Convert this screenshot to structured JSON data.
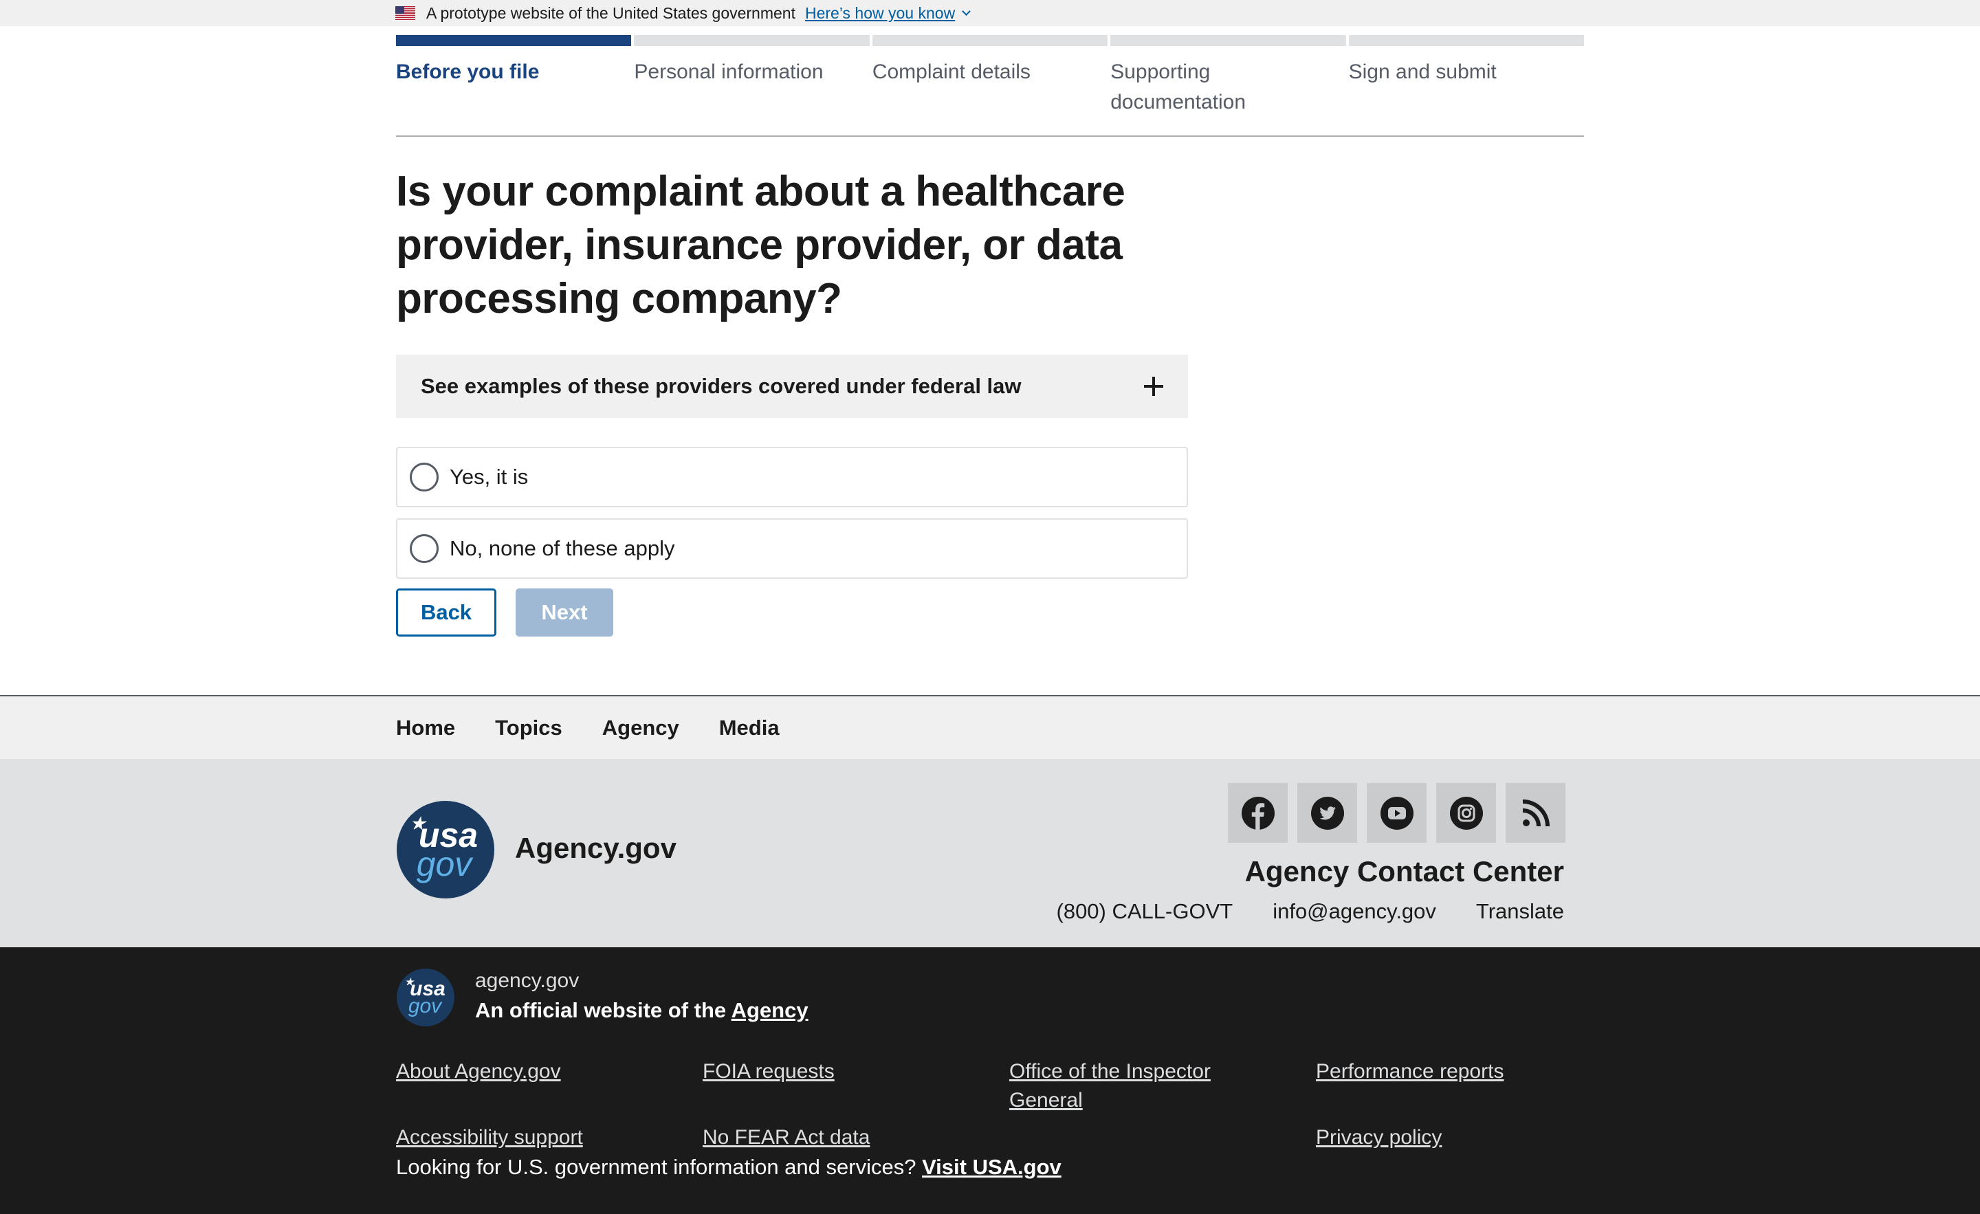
{
  "banner": {
    "text": "A prototype website of the United States government",
    "link": "Here’s how you know"
  },
  "steps": [
    {
      "label": "Before you file",
      "current": true
    },
    {
      "label": "Personal information",
      "current": false
    },
    {
      "label": "Complaint details",
      "current": false
    },
    {
      "label": "Supporting documentation",
      "current": false
    },
    {
      "label": "Sign and submit",
      "current": false
    }
  ],
  "main": {
    "question": "Is your complaint about a healthcare provider, insurance provider, or data processing company?",
    "accordion_label": "See examples of these providers covered under federal law",
    "options": [
      "Yes, it is",
      "No, none of these apply"
    ],
    "back_label": "Back",
    "next_label": "Next"
  },
  "footer_nav": [
    "Home",
    "Topics",
    "Agency",
    "Media"
  ],
  "footer": {
    "logo_usa": "usa",
    "logo_gov": "gov",
    "agency_name": "Agency.gov",
    "social_icons": [
      "facebook-icon",
      "twitter-icon",
      "youtube-icon",
      "instagram-icon",
      "rss-icon"
    ],
    "contact_title": "Agency Contact Center",
    "phone": "(800) CALL-GOVT",
    "email": "info@agency.gov",
    "translate": "Translate"
  },
  "identifier": {
    "domain": "agency.gov",
    "official_prefix": "An official website of the ",
    "official_link": "Agency",
    "links": [
      "About Agency.gov",
      "FOIA requests",
      "Office of the Inspector General",
      "Performance reports",
      "Accessibility support",
      "No FEAR Act data",
      "",
      "Privacy policy"
    ],
    "usa_prefix": "Looking for U.S. government information and services? ",
    "usa_link": "Visit USA.gov"
  },
  "colors": {
    "primary": "#005ea2",
    "primary_dark": "#1a4480",
    "disabled": "#9fb8d3",
    "footer_dark": "#1b1b1b"
  }
}
